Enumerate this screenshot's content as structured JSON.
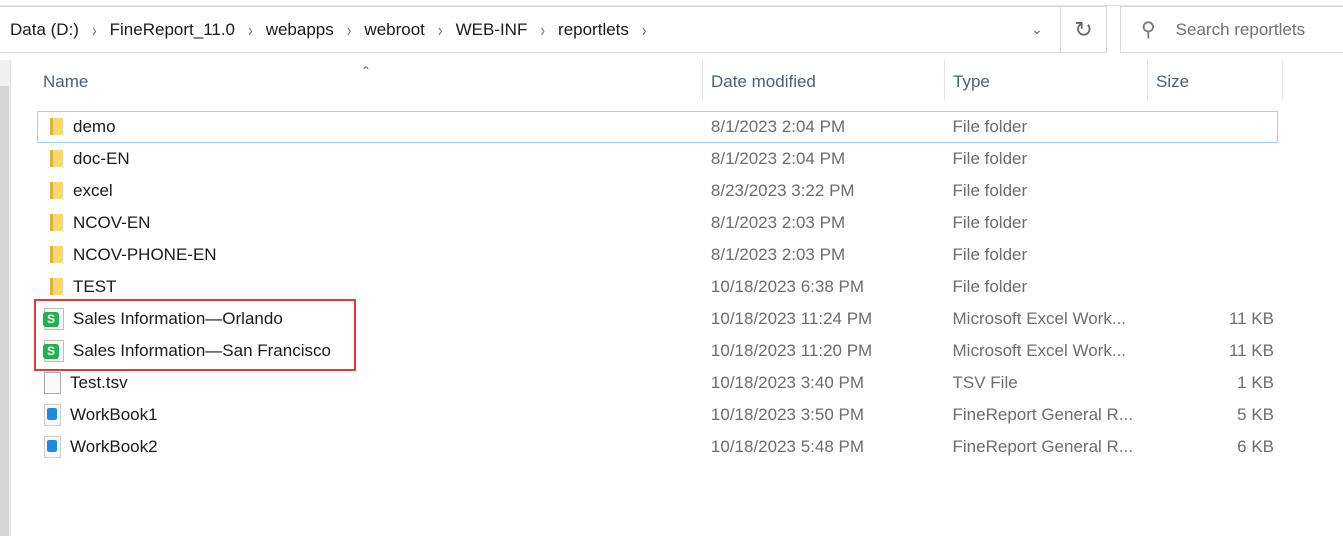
{
  "breadcrumb": [
    "Data (D:)",
    "FineReport_11.0",
    "webapps",
    "webroot",
    "WEB-INF",
    "reportlets"
  ],
  "search": {
    "placeholder": "Search reportlets"
  },
  "columns": {
    "name": "Name",
    "date": "Date modified",
    "type": "Type",
    "size": "Size"
  },
  "files": [
    {
      "name": "demo",
      "date": "8/1/2023 2:04 PM",
      "type": "File folder",
      "size": "",
      "icon": "folder"
    },
    {
      "name": "doc-EN",
      "date": "8/1/2023 2:04 PM",
      "type": "File folder",
      "size": "",
      "icon": "folder"
    },
    {
      "name": "excel",
      "date": "8/23/2023 3:22 PM",
      "type": "File folder",
      "size": "",
      "icon": "folder"
    },
    {
      "name": "NCOV-EN",
      "date": "8/1/2023 2:03 PM",
      "type": "File folder",
      "size": "",
      "icon": "folder"
    },
    {
      "name": "NCOV-PHONE-EN",
      "date": "8/1/2023 2:03 PM",
      "type": "File folder",
      "size": "",
      "icon": "folder"
    },
    {
      "name": "TEST",
      "date": "10/18/2023 6:38 PM",
      "type": "File folder",
      "size": "",
      "icon": "folder"
    },
    {
      "name": "Sales Information—Orlando",
      "date": "10/18/2023 11:24 PM",
      "type": "Microsoft Excel Work...",
      "size": "11 KB",
      "icon": "xls"
    },
    {
      "name": "Sales Information—San Francisco",
      "date": "10/18/2023 11:20 PM",
      "type": "Microsoft Excel Work...",
      "size": "11 KB",
      "icon": "xls"
    },
    {
      "name": "Test.tsv",
      "date": "10/18/2023 3:40 PM",
      "type": "TSV File",
      "size": "1 KB",
      "icon": "file"
    },
    {
      "name": "WorkBook1",
      "date": "10/18/2023 3:50 PM",
      "type": "FineReport General R...",
      "size": "5 KB",
      "icon": "fr"
    },
    {
      "name": "WorkBook2",
      "date": "10/18/2023 5:48 PM",
      "type": "FineReport General R...",
      "size": "6 KB",
      "icon": "fr"
    }
  ]
}
